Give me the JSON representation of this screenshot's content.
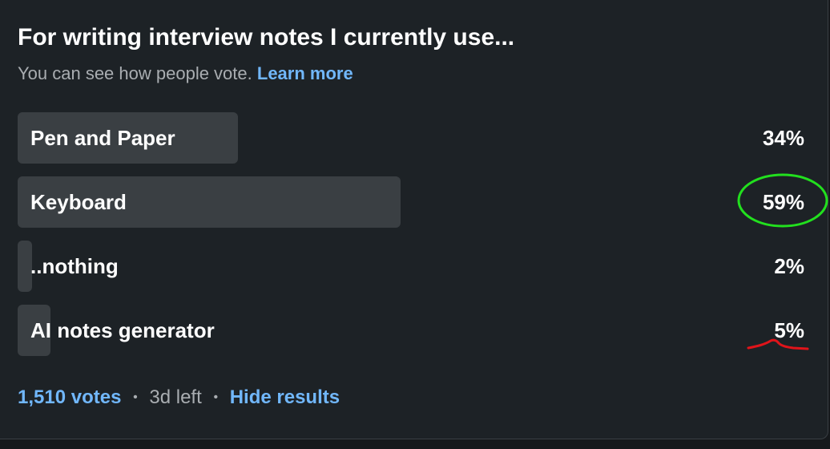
{
  "poll": {
    "question": "For writing interview notes I currently use...",
    "subtitle": "You can see how people vote.",
    "learn_more": "Learn more",
    "options": [
      {
        "label": "Pen and Paper",
        "percent": "34%",
        "fraction": 0.34
      },
      {
        "label": "Keyboard",
        "percent": "59%",
        "fraction": 0.59
      },
      {
        "label": "..nothing",
        "percent": "2%",
        "fraction": 0.02
      },
      {
        "label": "AI notes generator",
        "percent": "5%",
        "fraction": 0.05
      }
    ],
    "votes": "1,510 votes",
    "time_left": "3d left",
    "separator": "•",
    "hide_results": "Hide results"
  },
  "colors": {
    "background": "#1d2226",
    "bar": "#3a3f43",
    "link": "#71b7fb",
    "annotation_circle": "#22e01e",
    "annotation_underline": "#e0141a"
  },
  "annotations": {
    "circled_option": "Keyboard",
    "underlined_option": "AI notes generator"
  }
}
